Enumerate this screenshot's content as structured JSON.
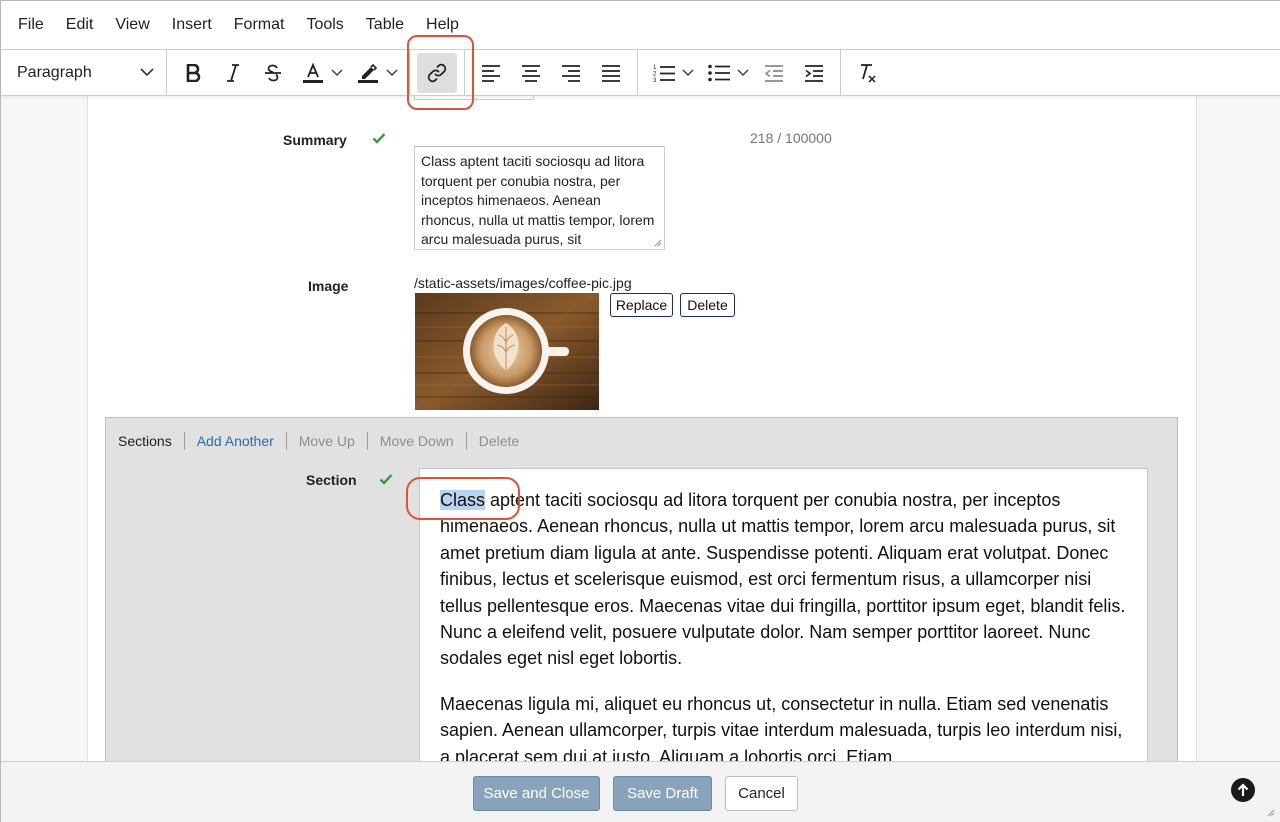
{
  "menu": [
    "File",
    "Edit",
    "View",
    "Insert",
    "Format",
    "Tools",
    "Table",
    "Help"
  ],
  "toolbar": {
    "block_format": "Paragraph",
    "buttons": {
      "bold": "bold-icon",
      "italic": "italic-icon",
      "strikethrough": "strikethrough-icon",
      "text_color": "text-color-icon",
      "highlight": "highlight-icon",
      "link": "link-icon",
      "align_left": "align-left-icon",
      "align_center": "align-center-icon",
      "align_right": "align-right-icon",
      "justify": "justify-icon",
      "numbered_list": "numbered-list-icon",
      "bullet_list": "bullet-list-icon",
      "outdent": "outdent-icon",
      "indent": "indent-icon",
      "clear_formatting": "clear-formatting-icon"
    },
    "active_button": "link"
  },
  "form": {
    "summary": {
      "label": "Summary",
      "counter": "218 / 100000",
      "value": "Class aptent taciti sociosqu ad litora torquent per conubia nostra, per inceptos himenaeos. Aenean rhoncus, nulla ut mattis tempor, lorem arcu malesuada purus, sit"
    },
    "image": {
      "label": "Image",
      "path": "/static-assets/images/coffee-pic.jpg",
      "replace_label": "Replace",
      "delete_label": "Delete"
    },
    "sections": {
      "bar": {
        "title": "Sections",
        "add": "Add Another",
        "move_up": "Move Up",
        "move_down": "Move Down",
        "delete": "Delete"
      },
      "section_label": "Section",
      "selected_word": "Class",
      "paragraph1_rest": " aptent taciti sociosqu ad litora torquent per conubia nostra, per inceptos himenaeos. Aenean rhoncus, nulla ut mattis tempor, lorem arcu malesuada purus, sit amet pretium diam ligula at ante. Suspendisse potenti. Aliquam erat volutpat. Donec finibus, lectus et scelerisque euismod, est orci fermentum risus, a ullamcorper nisi tellus pellentesque eros. Maecenas vitae dui fringilla, porttitor ipsum eget, blandit felis. Nunc a eleifend velit, posuere vulputate dolor. Nam semper porttitor laoreet. Nunc sodales eget nisl eget lobortis.",
      "paragraph2": "Maecenas ligula mi, aliquet eu rhoncus ut, consectetur in nulla. Etiam sed venenatis sapien. Aenean ullamcorper, turpis vitae interdum malesuada, turpis leo interdum nisi, a placerat sem dui at justo. Aliquam a lobortis orci. Etiam"
    }
  },
  "footer": {
    "save_close": "Save and Close",
    "save_draft": "Save Draft",
    "cancel": "Cancel"
  },
  "colors": {
    "annotation": "#e0503a",
    "selection": "#b7d3f0",
    "primary_button": "#8aa3bd",
    "link": "#2a6db5",
    "check": "#3a9a4a"
  }
}
